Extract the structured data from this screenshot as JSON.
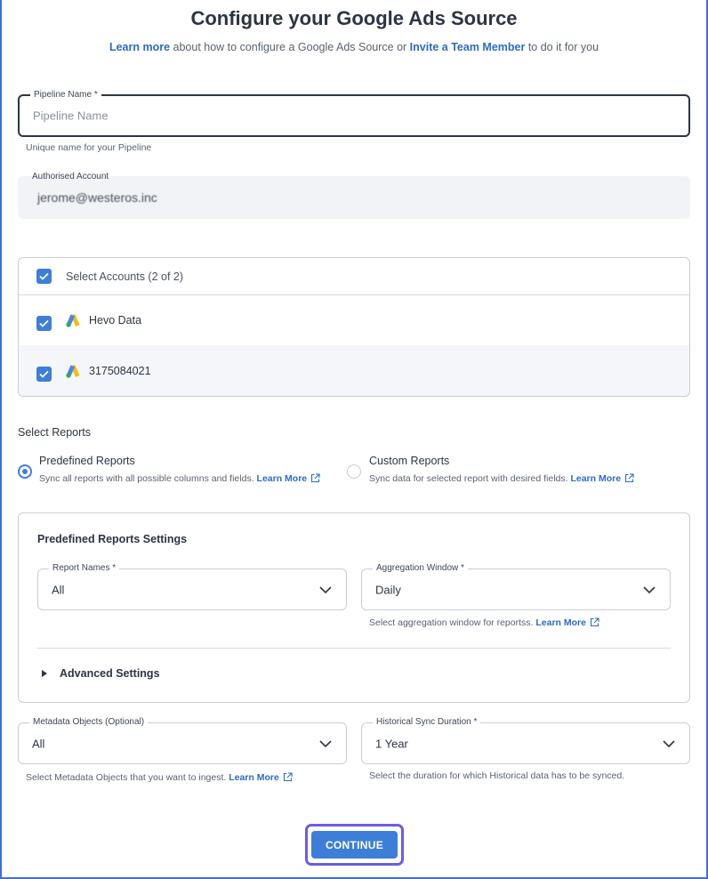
{
  "header": {
    "title": "Configure your Google Ads Source",
    "learn_more": "Learn more",
    "sub_middle": " about how to configure a Google Ads Source or ",
    "invite": "Invite a Team Member",
    "sub_end": " to do it for you"
  },
  "pipeline": {
    "label": "Pipeline Name *",
    "placeholder": "Pipeline Name",
    "hint": "Unique name for your Pipeline"
  },
  "authorised": {
    "label": "Authorised Account",
    "value": "jerome@westeros.inc"
  },
  "accounts": {
    "select_all_label": "Select Accounts (2 of 2)",
    "items": [
      {
        "name": "Hevo Data",
        "checked": true
      },
      {
        "name": "3175084021",
        "checked": true
      }
    ]
  },
  "reports": {
    "section_label": "Select Reports",
    "options": [
      {
        "title": "Predefined Reports",
        "desc": "Sync all reports with all possible columns and fields. ",
        "link": "Learn More",
        "selected": true
      },
      {
        "title": "Custom Reports",
        "desc": "Sync data for selected report with desired fields. ",
        "link": "Learn More",
        "selected": false
      }
    ]
  },
  "settings": {
    "title": "Predefined Reports Settings",
    "report_names": {
      "label": "Report Names *",
      "value": "All"
    },
    "aggregation": {
      "label": "Aggregation Window *",
      "value": "Daily",
      "hint": "Select aggregation window for reportss. ",
      "link": "Learn More"
    },
    "advanced": "Advanced Settings"
  },
  "metadata": {
    "label": "Metadata Objects (Optional)",
    "value": "All",
    "hint": "Select Metadata Objects that you want to ingest. ",
    "link": "Learn More"
  },
  "historical": {
    "label": "Historical Sync Duration *",
    "value": "1 Year",
    "hint": "Select the duration for which Historical data has to be synced."
  },
  "continue_label": "CONTINUE",
  "colors": {
    "accent": "#3d7ed9",
    "link": "#2c6bc7",
    "focus_ring": "#6b5ce7"
  }
}
